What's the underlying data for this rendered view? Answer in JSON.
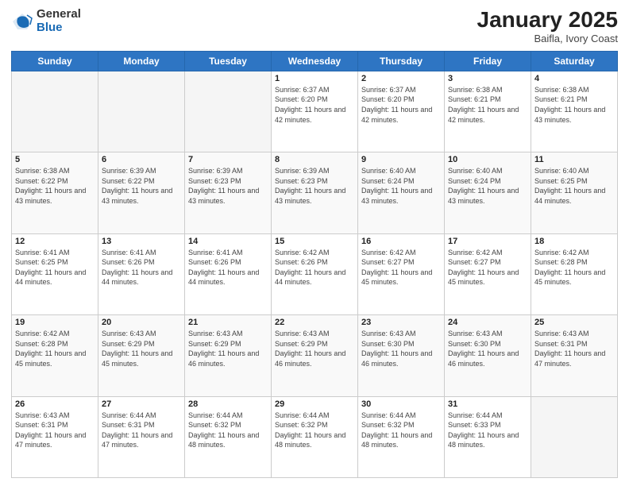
{
  "logo": {
    "general": "General",
    "blue": "Blue"
  },
  "header": {
    "title": "January 2025",
    "subtitle": "Baifla, Ivory Coast"
  },
  "weekdays": [
    "Sunday",
    "Monday",
    "Tuesday",
    "Wednesday",
    "Thursday",
    "Friday",
    "Saturday"
  ],
  "weeks": [
    [
      {
        "day": "",
        "empty": true
      },
      {
        "day": "",
        "empty": true
      },
      {
        "day": "",
        "empty": true
      },
      {
        "day": "1",
        "sunrise": "6:37 AM",
        "sunset": "6:20 PM",
        "daylight": "11 hours and 42 minutes."
      },
      {
        "day": "2",
        "sunrise": "6:37 AM",
        "sunset": "6:20 PM",
        "daylight": "11 hours and 42 minutes."
      },
      {
        "day": "3",
        "sunrise": "6:38 AM",
        "sunset": "6:21 PM",
        "daylight": "11 hours and 42 minutes."
      },
      {
        "day": "4",
        "sunrise": "6:38 AM",
        "sunset": "6:21 PM",
        "daylight": "11 hours and 43 minutes."
      }
    ],
    [
      {
        "day": "5",
        "sunrise": "6:38 AM",
        "sunset": "6:22 PM",
        "daylight": "11 hours and 43 minutes."
      },
      {
        "day": "6",
        "sunrise": "6:39 AM",
        "sunset": "6:22 PM",
        "daylight": "11 hours and 43 minutes."
      },
      {
        "day": "7",
        "sunrise": "6:39 AM",
        "sunset": "6:23 PM",
        "daylight": "11 hours and 43 minutes."
      },
      {
        "day": "8",
        "sunrise": "6:39 AM",
        "sunset": "6:23 PM",
        "daylight": "11 hours and 43 minutes."
      },
      {
        "day": "9",
        "sunrise": "6:40 AM",
        "sunset": "6:24 PM",
        "daylight": "11 hours and 43 minutes."
      },
      {
        "day": "10",
        "sunrise": "6:40 AM",
        "sunset": "6:24 PM",
        "daylight": "11 hours and 43 minutes."
      },
      {
        "day": "11",
        "sunrise": "6:40 AM",
        "sunset": "6:25 PM",
        "daylight": "11 hours and 44 minutes."
      }
    ],
    [
      {
        "day": "12",
        "sunrise": "6:41 AM",
        "sunset": "6:25 PM",
        "daylight": "11 hours and 44 minutes."
      },
      {
        "day": "13",
        "sunrise": "6:41 AM",
        "sunset": "6:26 PM",
        "daylight": "11 hours and 44 minutes."
      },
      {
        "day": "14",
        "sunrise": "6:41 AM",
        "sunset": "6:26 PM",
        "daylight": "11 hours and 44 minutes."
      },
      {
        "day": "15",
        "sunrise": "6:42 AM",
        "sunset": "6:26 PM",
        "daylight": "11 hours and 44 minutes."
      },
      {
        "day": "16",
        "sunrise": "6:42 AM",
        "sunset": "6:27 PM",
        "daylight": "11 hours and 45 minutes."
      },
      {
        "day": "17",
        "sunrise": "6:42 AM",
        "sunset": "6:27 PM",
        "daylight": "11 hours and 45 minutes."
      },
      {
        "day": "18",
        "sunrise": "6:42 AM",
        "sunset": "6:28 PM",
        "daylight": "11 hours and 45 minutes."
      }
    ],
    [
      {
        "day": "19",
        "sunrise": "6:42 AM",
        "sunset": "6:28 PM",
        "daylight": "11 hours and 45 minutes."
      },
      {
        "day": "20",
        "sunrise": "6:43 AM",
        "sunset": "6:29 PM",
        "daylight": "11 hours and 45 minutes."
      },
      {
        "day": "21",
        "sunrise": "6:43 AM",
        "sunset": "6:29 PM",
        "daylight": "11 hours and 46 minutes."
      },
      {
        "day": "22",
        "sunrise": "6:43 AM",
        "sunset": "6:29 PM",
        "daylight": "11 hours and 46 minutes."
      },
      {
        "day": "23",
        "sunrise": "6:43 AM",
        "sunset": "6:30 PM",
        "daylight": "11 hours and 46 minutes."
      },
      {
        "day": "24",
        "sunrise": "6:43 AM",
        "sunset": "6:30 PM",
        "daylight": "11 hours and 46 minutes."
      },
      {
        "day": "25",
        "sunrise": "6:43 AM",
        "sunset": "6:31 PM",
        "daylight": "11 hours and 47 minutes."
      }
    ],
    [
      {
        "day": "26",
        "sunrise": "6:43 AM",
        "sunset": "6:31 PM",
        "daylight": "11 hours and 47 minutes."
      },
      {
        "day": "27",
        "sunrise": "6:44 AM",
        "sunset": "6:31 PM",
        "daylight": "11 hours and 47 minutes."
      },
      {
        "day": "28",
        "sunrise": "6:44 AM",
        "sunset": "6:32 PM",
        "daylight": "11 hours and 48 minutes."
      },
      {
        "day": "29",
        "sunrise": "6:44 AM",
        "sunset": "6:32 PM",
        "daylight": "11 hours and 48 minutes."
      },
      {
        "day": "30",
        "sunrise": "6:44 AM",
        "sunset": "6:32 PM",
        "daylight": "11 hours and 48 minutes."
      },
      {
        "day": "31",
        "sunrise": "6:44 AM",
        "sunset": "6:33 PM",
        "daylight": "11 hours and 48 minutes."
      },
      {
        "day": "",
        "empty": true
      }
    ]
  ]
}
